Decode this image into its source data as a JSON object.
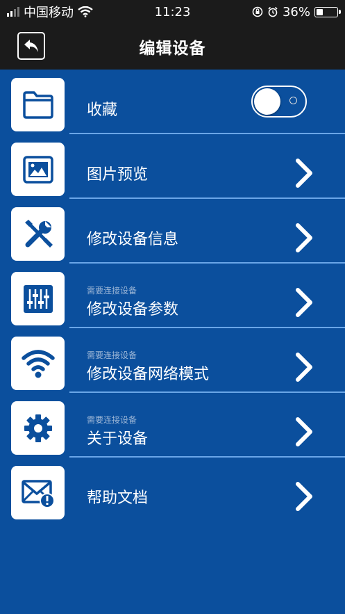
{
  "status_bar": {
    "carrier": "中国移动",
    "time": "11:23",
    "battery": "36%",
    "icons": [
      "signal-icon",
      "wifi-icon",
      "rotation-lock-icon",
      "alarm-icon",
      "battery-icon"
    ]
  },
  "header": {
    "title": "编辑设备",
    "back_icon": "back-arrow-icon"
  },
  "menu": {
    "items": [
      {
        "label": "收藏",
        "sublabel": "",
        "icon": "folder-icon",
        "control": "toggle",
        "toggle_on": false
      },
      {
        "label": "图片预览",
        "sublabel": "",
        "icon": "image-icon",
        "control": "chevron"
      },
      {
        "label": "修改设备信息",
        "sublabel": "",
        "icon": "tools-icon",
        "control": "chevron"
      },
      {
        "label": "修改设备参数",
        "sublabel": "需要连接设备",
        "icon": "sliders-icon",
        "control": "chevron"
      },
      {
        "label": "修改设备网络模式",
        "sublabel": "需要连接设备",
        "icon": "wifi-icon",
        "control": "chevron"
      },
      {
        "label": "关于设备",
        "sublabel": "需要连接设备",
        "icon": "gear-icon",
        "control": "chevron"
      },
      {
        "label": "帮助文档",
        "sublabel": "",
        "icon": "mail-alert-icon",
        "control": "chevron"
      }
    ]
  },
  "colors": {
    "background": "#0b4f9d",
    "bar": "#1b1b1b",
    "icon": "#0b4f9d",
    "divider": "#6aa6e8"
  }
}
